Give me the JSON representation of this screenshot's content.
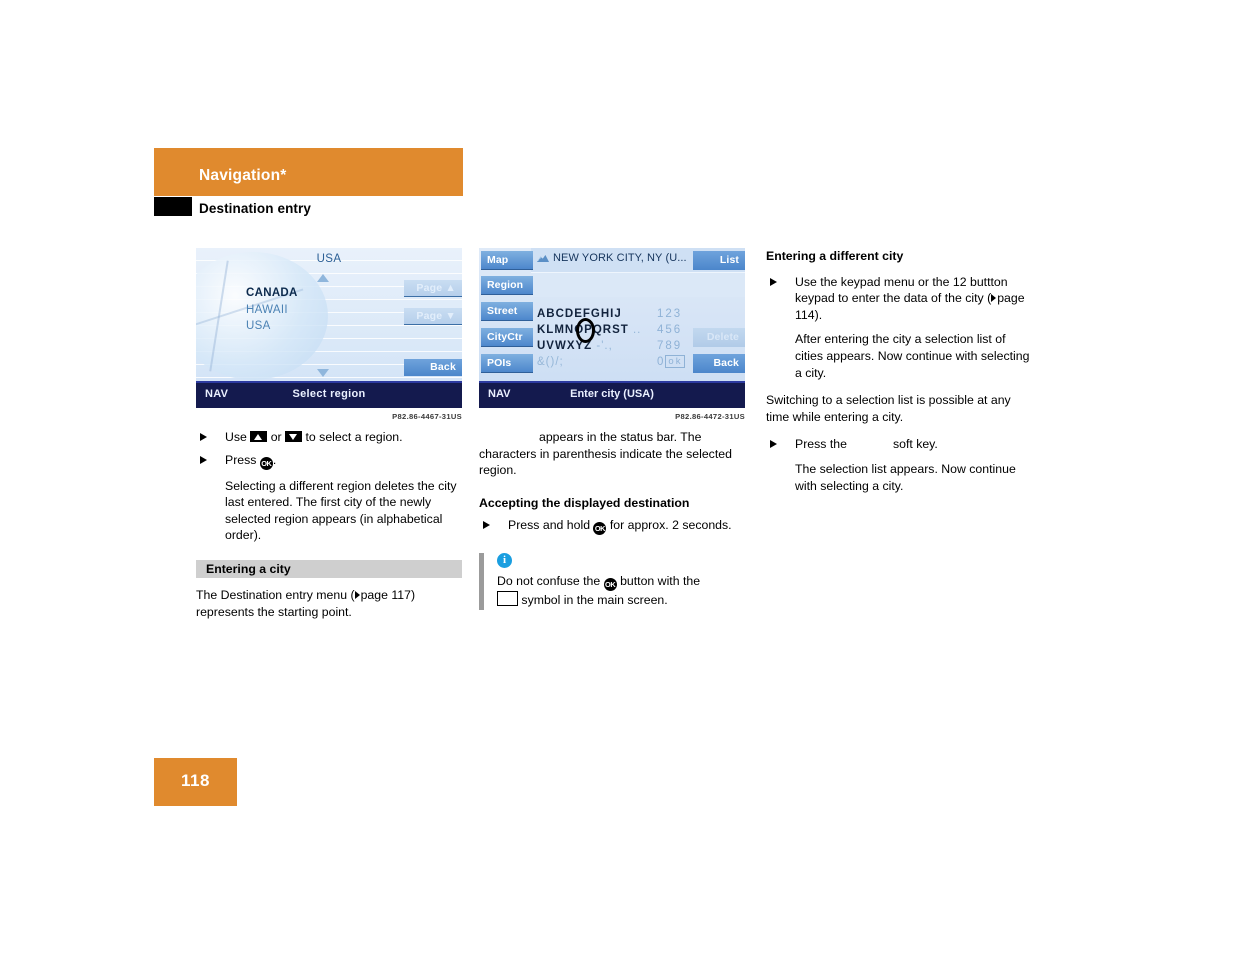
{
  "header": {
    "chapter": "Navigation*",
    "section": "Destination entry"
  },
  "footer": {
    "page_number": "118"
  },
  "colors": {
    "accent_orange": "#e08a2e",
    "nav_bar": "#141a4e",
    "softkey_blue": "#4b86cb",
    "info_blue": "#1a9ee0",
    "band_gray": "#cfcfcf"
  },
  "figures": [
    {
      "caption": "P82.86-4467-31US",
      "screen": {
        "title_top": "USA",
        "list": [
          {
            "label": "CANADA",
            "selected": true
          },
          {
            "label": "HAWAII",
            "selected": false
          },
          {
            "label": "USA",
            "selected": false
          }
        ],
        "softkeys": [
          {
            "label": "Page ▲",
            "state": "dim"
          },
          {
            "label": "Page ▼",
            "state": "dim"
          },
          {
            "label": "Back",
            "state": "active"
          }
        ],
        "status_left": "NAV",
        "status_center": "Select region"
      }
    },
    {
      "caption": "P82.86-4472-31US",
      "screen": {
        "destination": "NEW YORK CITY, NY (U...",
        "left_buttons": [
          "Map",
          "Region",
          "Street",
          "CityCtr",
          "POIs"
        ],
        "right_buttons": [
          {
            "label": "List",
            "state": "active"
          },
          {
            "label": "Delete",
            "state": "dim"
          },
          {
            "label": "Back",
            "state": "active"
          }
        ],
        "keypad_rows": [
          {
            "letters": "ABCDEFGHIJ",
            "extra": "",
            "numbers": "123"
          },
          {
            "letters": "KLMNOPQRST",
            "extra": "..",
            "numbers": "456"
          },
          {
            "letters": "UVWXYZ",
            "extra": "-'.,",
            "numbers": "789"
          },
          {
            "letters": "&()/;",
            "extra": "",
            "numbers": "0",
            "ok": "ok"
          }
        ],
        "cursor_char": "O",
        "status_left": "NAV",
        "status_center": "Enter city (USA)"
      }
    }
  ],
  "column1": {
    "bullet1_pre": "Use",
    "bullet1_mid": "or",
    "bullet1_post": "to select a region.",
    "bullet2_pre": "Press",
    "bullet2_post": ".",
    "paragraph1": "Selecting a different region deletes the city last entered. The first city of the newly selected region appears (in alphabetical order).",
    "heading_band": "Entering a city",
    "paragraph2_a": "The Destination entry menu (",
    "paragraph2_b": "page 117) represents the starting point."
  },
  "column2": {
    "paragraph1_lead": "appears in the status bar.",
    "paragraph1_rest": "The characters in parenthesis indicate the selected region.",
    "heading": "Accepting the displayed destination",
    "bullet1_pre": "Press and hold",
    "bullet1_post": "for approx. 2 seconds.",
    "note_pre": "Do not confuse the",
    "note_mid": "button with the",
    "note_post": "symbol in the main screen."
  },
  "column3": {
    "heading": "Entering a different city",
    "bullet1_a": "Use the keypad menu or the 12 buttton keypad to enter the data of the city (",
    "bullet1_b": "page 114).",
    "paragraph1": "After entering the city a selection list of cities appears. Now continue with selecting a city.",
    "paragraph2": "Switching to a selection list is possible at any time while entering a city.",
    "bullet2_pre": "Press the",
    "bullet2_post": "soft key.",
    "paragraph3": "The selection list appears. Now continue with selecting a city."
  }
}
